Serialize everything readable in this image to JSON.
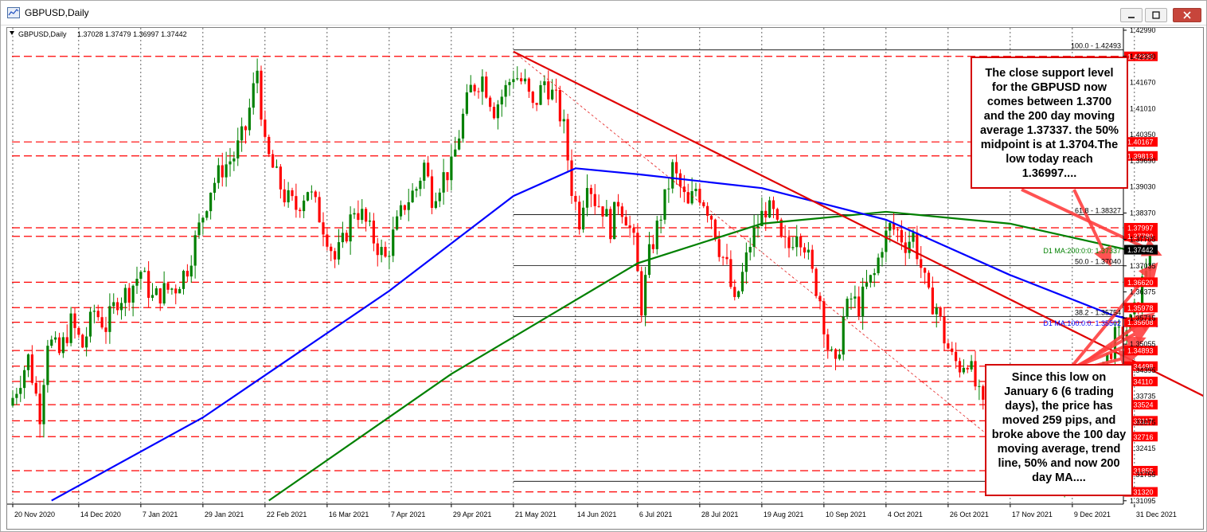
{
  "window": {
    "title": "GBPUSD,Daily"
  },
  "chart_info": {
    "symbol_tf": "GBPUSD,Daily",
    "ohlc": "1.37028 1.37479 1.36997 1.37442"
  },
  "colors": {
    "red": "#ff0000",
    "sma100": "#0000ff",
    "sma200": "#008000",
    "bull": "#008000",
    "bear": "#ff0000",
    "zone": "#ffff00",
    "price_badge": "#000000"
  },
  "chart_data": {
    "type": "candlestick",
    "ylim": [
      1.3101,
      1.4305
    ],
    "y_ticks": [
      1.4299,
      1.4233,
      1.4167,
      1.4101,
      1.4035,
      1.3969,
      1.3903,
      1.3837,
      1.37705,
      1.37035,
      1.36375,
      1.35715,
      1.35055,
      1.34395,
      1.33735,
      1.33075,
      1.32415,
      1.31755,
      1.31095
    ],
    "x_labels": [
      {
        "i": 0,
        "t": "20 Nov 2020"
      },
      {
        "i": 17,
        "t": "14 Dec 2020"
      },
      {
        "i": 33,
        "t": "7 Jan 2021"
      },
      {
        "i": 49,
        "t": "29 Jan 2021"
      },
      {
        "i": 65,
        "t": "22 Feb 2021"
      },
      {
        "i": 81,
        "t": "16 Mar 2021"
      },
      {
        "i": 97,
        "t": "7 Apr 2021"
      },
      {
        "i": 113,
        "t": "29 Apr 2021"
      },
      {
        "i": 129,
        "t": "21 May 2021"
      },
      {
        "i": 145,
        "t": "14 Jun 2021"
      },
      {
        "i": 161,
        "t": "6 Jul 2021"
      },
      {
        "i": 177,
        "t": "28 Jul 2021"
      },
      {
        "i": 193,
        "t": "19 Aug 2021"
      },
      {
        "i": 209,
        "t": "10 Sep 2021"
      },
      {
        "i": 225,
        "t": "4 Oct 2021"
      },
      {
        "i": 241,
        "t": "26 Oct 2021"
      },
      {
        "i": 257,
        "t": "17 Nov 2021"
      },
      {
        "i": 273,
        "t": "9 Dec 2021"
      },
      {
        "i": 289,
        "t": "31 Dec 2021"
      }
    ],
    "anchors": [
      [
        0,
        1.337
      ],
      [
        4,
        1.347
      ],
      [
        7,
        1.333
      ],
      [
        9,
        1.352
      ],
      [
        12,
        1.348
      ],
      [
        15,
        1.356
      ],
      [
        18,
        1.35
      ],
      [
        21,
        1.359
      ],
      [
        24,
        1.355
      ],
      [
        27,
        1.362
      ],
      [
        30,
        1.364
      ],
      [
        33,
        1.369
      ],
      [
        36,
        1.362
      ],
      [
        39,
        1.364
      ],
      [
        42,
        1.365
      ],
      [
        45,
        1.37
      ],
      [
        48,
        1.38
      ],
      [
        51,
        1.39
      ],
      [
        54,
        1.395
      ],
      [
        57,
        1.398
      ],
      [
        60,
        1.405
      ],
      [
        62,
        1.415
      ],
      [
        63,
        1.42
      ],
      [
        65,
        1.4
      ],
      [
        67,
        1.395
      ],
      [
        70,
        1.388
      ],
      [
        73,
        1.385
      ],
      [
        76,
        1.39
      ],
      [
        79,
        1.383
      ],
      [
        81,
        1.378
      ],
      [
        83,
        1.372
      ],
      [
        85,
        1.376
      ],
      [
        88,
        1.385
      ],
      [
        90,
        1.383
      ],
      [
        93,
        1.377
      ],
      [
        96,
        1.372
      ],
      [
        98,
        1.378
      ],
      [
        101,
        1.386
      ],
      [
        104,
        1.39
      ],
      [
        106,
        1.396
      ],
      [
        108,
        1.388
      ],
      [
        111,
        1.393
      ],
      [
        113,
        1.395
      ],
      [
        116,
        1.408
      ],
      [
        118,
        1.415
      ],
      [
        121,
        1.418
      ],
      [
        124,
        1.41
      ],
      [
        127,
        1.415
      ],
      [
        129,
        1.419
      ],
      [
        132,
        1.416
      ],
      [
        134,
        1.41
      ],
      [
        137,
        1.417
      ],
      [
        140,
        1.412
      ],
      [
        142,
        1.405
      ],
      [
        144,
        1.39
      ],
      [
        146,
        1.382
      ],
      [
        148,
        1.393
      ],
      [
        150,
        1.387
      ],
      [
        152,
        1.385
      ],
      [
        154,
        1.38
      ],
      [
        156,
        1.387
      ],
      [
        158,
        1.383
      ],
      [
        160,
        1.376
      ],
      [
        162,
        1.36
      ],
      [
        164,
        1.373
      ],
      [
        166,
        1.38
      ],
      [
        168,
        1.387
      ],
      [
        170,
        1.395
      ],
      [
        172,
        1.39
      ],
      [
        174,
        1.385
      ],
      [
        176,
        1.39
      ],
      [
        178,
        1.387
      ],
      [
        180,
        1.383
      ],
      [
        182,
        1.375
      ],
      [
        184,
        1.37
      ],
      [
        186,
        1.36
      ],
      [
        188,
        1.368
      ],
      [
        190,
        1.376
      ],
      [
        192,
        1.381
      ],
      [
        194,
        1.385
      ],
      [
        196,
        1.383
      ],
      [
        198,
        1.376
      ],
      [
        200,
        1.375
      ],
      [
        202,
        1.38
      ],
      [
        204,
        1.376
      ],
      [
        206,
        1.368
      ],
      [
        208,
        1.362
      ],
      [
        210,
        1.35
      ],
      [
        212,
        1.344
      ],
      [
        214,
        1.357
      ],
      [
        216,
        1.362
      ],
      [
        218,
        1.36
      ],
      [
        220,
        1.365
      ],
      [
        222,
        1.368
      ],
      [
        224,
        1.376
      ],
      [
        226,
        1.38
      ],
      [
        228,
        1.379
      ],
      [
        230,
        1.376
      ],
      [
        232,
        1.378
      ],
      [
        234,
        1.37
      ],
      [
        236,
        1.362
      ],
      [
        238,
        1.36
      ],
      [
        240,
        1.352
      ],
      [
        242,
        1.347
      ],
      [
        244,
        1.345
      ],
      [
        246,
        1.347
      ],
      [
        248,
        1.34
      ],
      [
        250,
        1.334
      ],
      [
        252,
        1.339
      ],
      [
        254,
        1.335
      ],
      [
        256,
        1.328
      ],
      [
        258,
        1.323
      ],
      [
        260,
        1.325
      ],
      [
        262,
        1.32
      ],
      [
        264,
        1.318
      ],
      [
        266,
        1.324
      ],
      [
        268,
        1.32
      ],
      [
        270,
        1.317
      ],
      [
        272,
        1.319
      ],
      [
        274,
        1.325
      ],
      [
        276,
        1.331
      ],
      [
        278,
        1.339
      ],
      [
        280,
        1.345
      ],
      [
        282,
        1.347
      ],
      [
        284,
        1.352
      ],
      [
        286,
        1.353
      ],
      [
        288,
        1.356
      ],
      [
        290,
        1.361
      ],
      [
        291,
        1.366
      ],
      [
        292,
        1.37
      ],
      [
        293,
        1.3744
      ]
    ],
    "sma200": [
      [
        66,
        1.311
      ],
      [
        113,
        1.343
      ],
      [
        161,
        1.371
      ],
      [
        193,
        1.381
      ],
      [
        225,
        1.384
      ],
      [
        257,
        1.381
      ],
      [
        289,
        1.374
      ],
      [
        295,
        1.37337
      ]
    ],
    "sma100": [
      [
        10,
        1.311
      ],
      [
        49,
        1.332
      ],
      [
        97,
        1.364
      ],
      [
        129,
        1.388
      ],
      [
        145,
        1.395
      ],
      [
        161,
        1.3935
      ],
      [
        193,
        1.39
      ],
      [
        225,
        1.382
      ],
      [
        257,
        1.368
      ],
      [
        283,
        1.358
      ],
      [
        295,
        1.355
      ]
    ],
    "fib_levels": [
      {
        "label": "100.0 - 1.42493",
        "value": 1.42493
      },
      {
        "label": "61.8 - 1.38327",
        "value": 1.38327
      },
      {
        "label": "50.0 - 1.37040",
        "value": 1.3704
      },
      {
        "label": "38.2 - 1.35754",
        "value": 1.35754
      },
      {
        "label": "1.31588",
        "value": 1.31588
      }
    ],
    "fib_start_index": 129,
    "ma_labels": [
      {
        "label": "D1 MA:200:0:0: 1.37337",
        "value": 1.37337,
        "color": "#008000"
      },
      {
        "label": "D1 MA:100:0:0: 1.35502",
        "value": 1.35502,
        "color": "#0000ff"
      }
    ],
    "h_levels": [
      1.4233,
      1.40167,
      1.39813,
      1.37997,
      1.3778,
      1.3662,
      1.35978,
      1.35608,
      1.34893,
      1.34498,
      1.3411,
      1.33524,
      1.33117,
      1.32716,
      1.31855,
      1.3132
    ],
    "h_level_labels": [
      "1.42330",
      "1.40167",
      "1.39813",
      "1.37997",
      "1.37780",
      "1.36620",
      "1.35978",
      "1.35608",
      "1.34893",
      "1.34498",
      "1.34110",
      "1.33524",
      "1.33117",
      "1.32716",
      "1.31855",
      "1.31320"
    ],
    "current_price": {
      "label": "1.37442",
      "value": 1.37442
    },
    "trend_line": {
      "start": [
        129,
        1.4245
      ],
      "end": [
        322,
        1.33
      ]
    },
    "diagonal_dashed": {
      "start": [
        129,
        1.4245
      ],
      "end": [
        266,
        1.31588
      ]
    },
    "support_zone": {
      "from_index": 293,
      "top": 1.3733,
      "bottom": 1.3704
    },
    "jan6_line": {
      "from_index": 288,
      "value": 1.348
    }
  },
  "annotations": {
    "top": "The close support level for the GBPUSD now comes between 1.3700 and the 200 day moving average 1.37337. the 50% midpoint is at 1.3704.The low today reach 1.36997....",
    "bottom": "Since this low on January 6 (6 trading days), the price has moved 259 pips, and broke above the 100 day moving average, trend line, 50% and now 200 day MA...."
  }
}
